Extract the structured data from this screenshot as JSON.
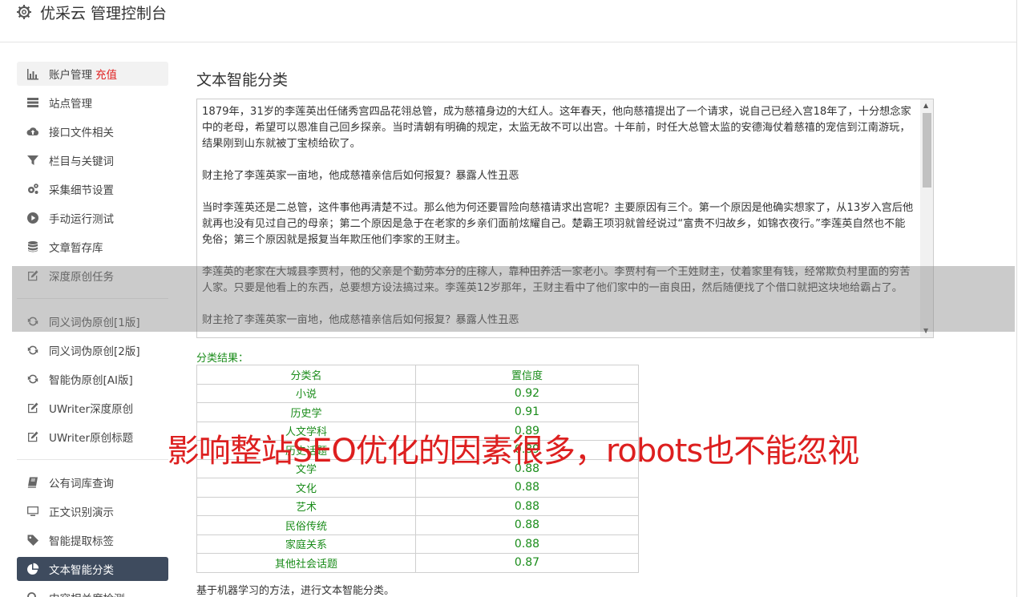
{
  "header": {
    "title": "优采云 管理控制台",
    "icon": "gear-icon"
  },
  "sidebar": {
    "items": [
      {
        "label": "账户管理",
        "tag": "充值",
        "icon": "bar-chart-icon"
      },
      {
        "label": "站点管理",
        "icon": "server-icon"
      },
      {
        "label": "接口文件相关",
        "icon": "cloud-upload-icon"
      },
      {
        "label": "栏目与关键词",
        "icon": "filter-icon"
      },
      {
        "label": "采集细节设置",
        "icon": "gears-icon"
      },
      {
        "label": "手动运行测试",
        "icon": "play-circle-icon"
      },
      {
        "label": "文章暂存库",
        "icon": "database-icon"
      },
      {
        "label": "深度原创任务",
        "icon": "edit-icon"
      },
      {
        "label": "同义词伪原创[1版]",
        "icon": "refresh-icon"
      },
      {
        "label": "同义词伪原创[2版]",
        "icon": "refresh-icon"
      },
      {
        "label": "智能伪原创[AI版]",
        "icon": "refresh-icon"
      },
      {
        "label": "UWriter深度原创",
        "icon": "edit-icon"
      },
      {
        "label": "UWriter原创标题",
        "icon": "edit-icon"
      },
      {
        "label": "公有词库查询",
        "icon": "book-icon"
      },
      {
        "label": "正文识别演示",
        "icon": "monitor-icon"
      },
      {
        "label": "智能提取标签",
        "icon": "tag-icon"
      },
      {
        "label": "文本智能分类",
        "icon": "pie-chart-icon"
      },
      {
        "label": "内容相关度检测",
        "icon": "search-icon"
      }
    ]
  },
  "main": {
    "title": "文本智能分类",
    "textarea": {
      "paragraphs": [
        "1879年，31岁的李莲英出任储秀宫四品花翎总管，成为慈禧身边的大红人。这年春天，他向慈禧提出了一个请求，说自己已经入宫18年了，十分想念家中的老母，希望可以恩准自己回乡探亲。当时清朝有明确的规定，太监无故不可以出宫。十年前，时任大总管太监的安德海仗着慈禧的宠信到江南游玩，结果刚到山东就被丁宝桢给砍了。",
        "财主抢了李莲英家一亩地，他成慈禧亲信后如何报复？暴露人性丑恶",
        "当时李莲英还是二总管，这件事他再清楚不过。那么他为何还要冒险向慈禧请求出宫呢？主要原因有三个。第一个原因是他确实想家了，从13岁入宫后他就再也没有见过自己的母亲；第二个原因是急于在老家的乡亲们面前炫耀自己。楚霸王项羽就曾经说过“富贵不归故乡，如锦衣夜行。”李莲英自然也不能免俗；第三个原因就是报复当年欺压他们李家的王财主。",
        "李莲英的老家在大城县李贾村，他的父亲是个勤劳本分的庄稼人，靠种田养活一家老小。李贾村有一个王姓财主，仗着家里有钱，经常欺负村里面的穷苦人家。只要是他看上的东西，总要想方设法搞过来。李莲英12岁那年，王财主看中了他们家中的一亩良田，然后随便找了个借口就把这块地给霸占了。",
        "财主抢了李莲英家一亩地，他成慈禧亲信后如何报复？暴露人性丑恶"
      ]
    },
    "result_label": "分类结果：",
    "table": {
      "headers": [
        "分类名",
        "置信度"
      ],
      "rows": [
        [
          "小说",
          "0.92"
        ],
        [
          "历史学",
          "0.91"
        ],
        [
          "人文学科",
          "0.89"
        ],
        [
          "历史话题",
          "0.89"
        ],
        [
          "文学",
          "0.88"
        ],
        [
          "文化",
          "0.88"
        ],
        [
          "艺术",
          "0.88"
        ],
        [
          "民俗传统",
          "0.88"
        ],
        [
          "家庭关系",
          "0.88"
        ],
        [
          "其他社会话题",
          "0.87"
        ]
      ]
    },
    "footer_note": "基于机器学习的方法，进行文本智能分类。"
  },
  "banner": {
    "text": "影响整站SEO优化的因素很多，robots也不能忽视"
  }
}
